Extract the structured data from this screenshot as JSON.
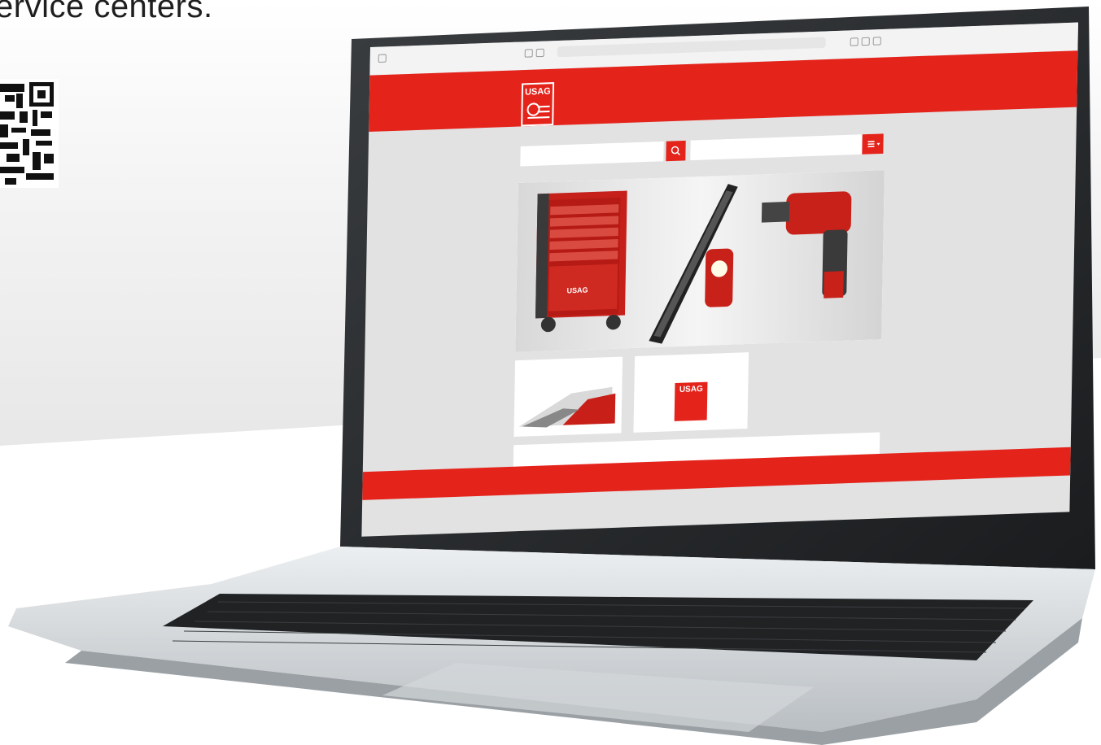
{
  "headline": "ervice centers.",
  "browser": {
    "url": "",
    "tab": ""
  },
  "site": {
    "logo_text": "USAG",
    "top_note": "",
    "top_right": "",
    "nav": [],
    "search_placeholder": "",
    "help_text": [],
    "card1_title": "",
    "card2_title": "",
    "card2_logo": "USAG",
    "info_left": "",
    "info_right": [],
    "footer_left": "",
    "footer_right": "",
    "hero_logo": "USAG"
  },
  "colors": {
    "brand_red": "#e4231b"
  }
}
